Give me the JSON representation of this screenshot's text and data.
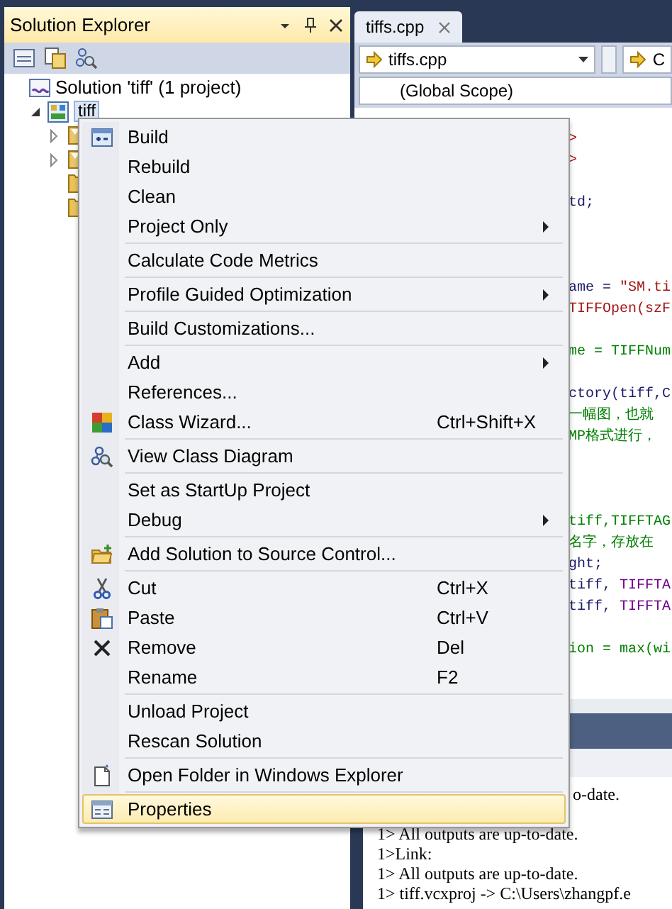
{
  "solution_explorer": {
    "title": "Solution Explorer",
    "tree": [
      {
        "label": "Solution 'tiff' (1 project)",
        "kind": "solution",
        "children": [
          {
            "label": "tiff",
            "kind": "project",
            "selected": true,
            "expanded": true,
            "children": [
              {
                "kind": "filter",
                "expanded": false
              },
              {
                "kind": "filter",
                "expanded": false
              },
              {
                "kind": "folder"
              },
              {
                "kind": "folder"
              }
            ]
          }
        ]
      }
    ]
  },
  "editor": {
    "tab": {
      "label": "tiffs.cpp",
      "selected": true
    },
    "file_dropdown": "tiffs.cpp",
    "member_dropdown": "C",
    "scope": "(Global Scope)",
    "code_lines": [
      {
        "kind": "code",
        "segments": [
          {
            "text": ">",
            "kind": "string"
          }
        ]
      },
      {
        "kind": "code",
        "segments": [
          {
            "text": ">",
            "kind": "string"
          }
        ]
      },
      {
        "kind": "blank"
      },
      {
        "kind": "code",
        "segments": [
          {
            "text": "td;",
            "kind": "plain"
          }
        ]
      },
      {
        "kind": "blank"
      },
      {
        "kind": "blank"
      },
      {
        "kind": "blank"
      },
      {
        "kind": "code",
        "segments": [
          {
            "text": "ame = ",
            "kind": "plain"
          },
          {
            "text": "\"SM.ti",
            "kind": "string"
          }
        ]
      },
      {
        "kind": "code",
        "segments": [
          {
            "text": "TIFFOpen(szF",
            "kind": "string"
          }
        ]
      },
      {
        "kind": "blank"
      },
      {
        "kind": "code",
        "segments": [
          {
            "text": "me = TIFFNum",
            "kind": "comment"
          }
        ]
      },
      {
        "kind": "blank"
      },
      {
        "kind": "code",
        "segments": [
          {
            "text": "ctory(tiff,C",
            "kind": "plain"
          }
        ]
      },
      {
        "kind": "code",
        "segments": [
          {
            "text": "一幅图，也就",
            "kind": "comment"
          }
        ]
      },
      {
        "kind": "code",
        "segments": [
          {
            "text": "MP格式进行，",
            "kind": "comment"
          }
        ]
      },
      {
        "kind": "blank"
      },
      {
        "kind": "blank"
      },
      {
        "kind": "blank"
      },
      {
        "kind": "code",
        "segments": [
          {
            "text": "tiff,TIFFTAG",
            "kind": "comment"
          }
        ]
      },
      {
        "kind": "code",
        "segments": [
          {
            "text": "名字，存放在",
            "kind": "comment"
          }
        ]
      },
      {
        "kind": "code",
        "segments": [
          {
            "text": "ght;",
            "kind": "plain"
          }
        ]
      },
      {
        "kind": "code",
        "segments": [
          {
            "text": "tiff, ",
            "kind": "plain"
          },
          {
            "text": "TIFFTA",
            "kind": "macro"
          }
        ]
      },
      {
        "kind": "code",
        "segments": [
          {
            "text": "tiff, ",
            "kind": "plain"
          },
          {
            "text": "TIFFTA",
            "kind": "macro"
          }
        ]
      },
      {
        "kind": "blank"
      },
      {
        "kind": "code",
        "segments": [
          {
            "text": "ion = max(wi",
            "kind": "comment"
          }
        ]
      }
    ]
  },
  "output": {
    "lines": [
      {
        "kind": "partial",
        "text": "o-date."
      },
      {
        "kind": "blank"
      },
      {
        "kind": "full",
        "text": "1>  All outputs are up-to-date."
      },
      {
        "kind": "full",
        "text": "1>Link:"
      },
      {
        "kind": "full",
        "text": "1>  All outputs are up-to-date."
      },
      {
        "kind": "full",
        "text": "1>  tiff.vcxproj -> C:\\Users\\zhangpf.e"
      }
    ]
  },
  "context_menu": {
    "groups": [
      [
        {
          "label": "Build",
          "kind": "build",
          "submenu": false,
          "selected": false
        },
        {
          "label": "Rebuild",
          "kind": "plain",
          "submenu": false,
          "selected": false
        },
        {
          "label": "Clean",
          "kind": "plain",
          "submenu": false,
          "selected": false
        },
        {
          "label": "Project Only",
          "kind": "plain",
          "submenu": true,
          "selected": false
        }
      ],
      [
        {
          "label": "Calculate Code Metrics",
          "kind": "plain",
          "submenu": false,
          "selected": false
        }
      ],
      [
        {
          "label": "Profile Guided Optimization",
          "kind": "plain",
          "submenu": true,
          "selected": false
        }
      ],
      [
        {
          "label": "Build Customizations...",
          "kind": "plain",
          "submenu": false,
          "selected": false
        }
      ],
      [
        {
          "label": "Add",
          "kind": "plain",
          "submenu": true,
          "selected": false
        },
        {
          "label": "References...",
          "kind": "plain",
          "submenu": false,
          "selected": false
        },
        {
          "label": "Class Wizard...",
          "kind": "wizard",
          "shortcut": "Ctrl+Shift+X",
          "submenu": false,
          "selected": false
        }
      ],
      [
        {
          "label": "View Class Diagram",
          "kind": "diagram",
          "submenu": false,
          "selected": false
        }
      ],
      [
        {
          "label": "Set as StartUp Project",
          "kind": "plain",
          "submenu": false,
          "selected": false
        },
        {
          "label": "Debug",
          "kind": "plain",
          "submenu": true,
          "selected": false
        }
      ],
      [
        {
          "label": "Add Solution to Source Control...",
          "kind": "source",
          "submenu": false,
          "selected": false
        }
      ],
      [
        {
          "label": "Cut",
          "kind": "cut",
          "shortcut": "Ctrl+X",
          "submenu": false,
          "selected": false
        },
        {
          "label": "Paste",
          "kind": "paste",
          "shortcut": "Ctrl+V",
          "submenu": false,
          "selected": false
        },
        {
          "label": "Remove",
          "kind": "remove",
          "shortcut": "Del",
          "submenu": false,
          "selected": false
        },
        {
          "label": "Rename",
          "kind": "plain",
          "shortcut": "F2",
          "submenu": false,
          "selected": false
        }
      ],
      [
        {
          "label": "Unload Project",
          "kind": "plain",
          "submenu": false,
          "selected": false
        },
        {
          "label": "Rescan Solution",
          "kind": "plain",
          "submenu": false,
          "selected": false
        }
      ],
      [
        {
          "label": "Open Folder in Windows Explorer",
          "kind": "explorer",
          "submenu": false,
          "selected": false
        }
      ],
      [
        {
          "label": "Properties",
          "kind": "properties",
          "submenu": false,
          "selected": true
        }
      ]
    ]
  }
}
